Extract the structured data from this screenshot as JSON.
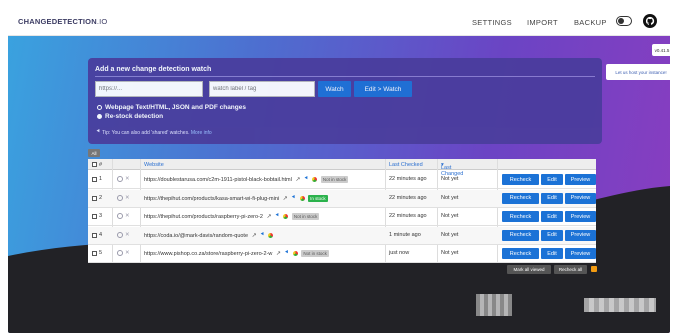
{
  "header": {
    "logo_bold": "CHANGEDETECTION",
    "logo_thin": ".IO",
    "nav": [
      "SETTINGS",
      "IMPORT",
      "BACKUP"
    ]
  },
  "version": "v0.41.5",
  "host_badge": "Let us host your instance!",
  "add_box": {
    "title": "Add a new change detection watch",
    "url_placeholder": "https://...",
    "tag_placeholder": "watch label / tag",
    "watch_label": "Watch",
    "edit_watch_label": "Edit > Watch",
    "radio_options": [
      "Webpage Text/HTML, JSON and PDF changes",
      "Re-stock detection"
    ],
    "selected_radio": 1,
    "tip": "Tip: You can also add 'shared' watches.",
    "tip_link": "More info"
  },
  "tag_filter": "All",
  "table": {
    "headers": {
      "num": "#",
      "website": "Website",
      "last_checked": "Last Checked",
      "last_changed": "Last Changed"
    },
    "rows": [
      {
        "num": "1",
        "url": "https://doublestarusa.com/c2m-1911-pistol-black-bobtail.html",
        "stock": "Not in stock",
        "in_stock": false,
        "last_checked": "22 minutes ago",
        "last_changed": "Not yet"
      },
      {
        "num": "2",
        "url": "https://thepihut.com/products/kasa-smart-wi-fi-plug-mini",
        "stock": "In stock",
        "in_stock": true,
        "last_checked": "22 minutes ago",
        "last_changed": "Not yet"
      },
      {
        "num": "3",
        "url": "https://thepihut.com/products/raspberry-pi-zero-2",
        "stock": "Not in stock",
        "in_stock": false,
        "last_checked": "22 minutes ago",
        "last_changed": "Not yet"
      },
      {
        "num": "4",
        "url": "https://coda.io/@mark-davis/random-quote",
        "stock": "",
        "in_stock": null,
        "last_checked": "1 minute ago",
        "last_changed": "Not yet"
      },
      {
        "num": "5",
        "url": "https://www.pishop.co.za/store/raspberry-pi-zero-2-w",
        "stock": "Not in stock",
        "in_stock": false,
        "last_checked": "just now",
        "last_changed": "Not yet"
      }
    ],
    "actions": [
      "Recheck",
      "Edit",
      "Preview"
    ]
  },
  "bottom": {
    "mark_all": "Mark all viewed",
    "recheck_all": "Recheck all"
  },
  "colors": {
    "accent": "#1b72d6",
    "in_stock": "#2bb24c"
  }
}
